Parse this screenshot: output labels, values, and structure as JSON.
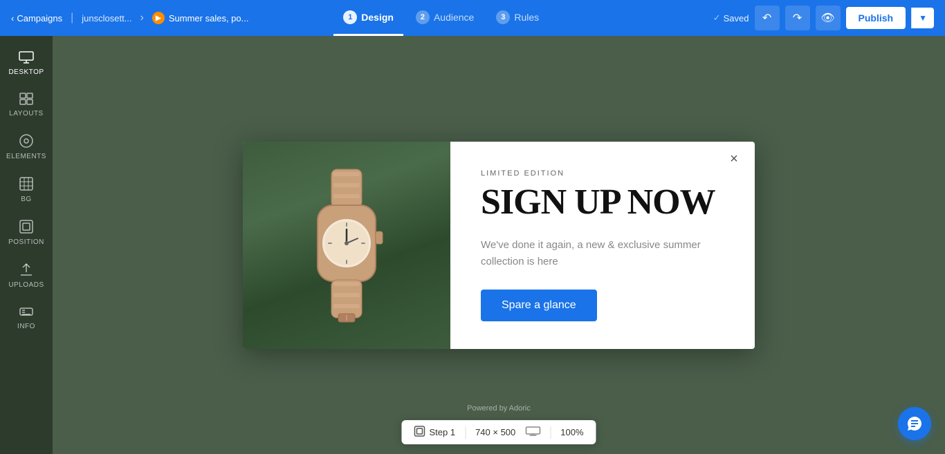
{
  "topnav": {
    "back_label": "Campaigns",
    "breadcrumb": "junsclosett...",
    "current": "Summer sales, po...",
    "steps": [
      {
        "num": "1",
        "label": "Design"
      },
      {
        "num": "2",
        "label": "Audience"
      },
      {
        "num": "3",
        "label": "Rules"
      }
    ],
    "saved_label": "Saved",
    "publish_label": "Publish"
  },
  "sidebar": {
    "items": [
      {
        "id": "desktop",
        "label": "Desktop",
        "icon": "🖥"
      },
      {
        "id": "layouts",
        "label": "Layouts",
        "icon": "⊞"
      },
      {
        "id": "elements",
        "label": "Elements",
        "icon": "◎"
      },
      {
        "id": "bg",
        "label": "BG",
        "icon": "▦"
      },
      {
        "id": "position",
        "label": "Position",
        "icon": "⊡"
      },
      {
        "id": "uploads",
        "label": "Uploads",
        "icon": "↑"
      },
      {
        "id": "info",
        "label": "Info",
        "icon": "⌨"
      }
    ]
  },
  "popup": {
    "close_icon": "×",
    "subtitle": "LIMITED EDITION",
    "title": "SIGN UP NOW",
    "body": "We've done it again, a new & exclusive summer collection is here",
    "cta_label": "Spare a glance"
  },
  "powered_by": "Powered by Adoric",
  "bottom_bar": {
    "step_icon": "⊡",
    "step_label": "Step 1",
    "size": "740 × 500",
    "device_icon": "▭",
    "zoom": "100%"
  },
  "chat": {
    "icon": "💬"
  }
}
